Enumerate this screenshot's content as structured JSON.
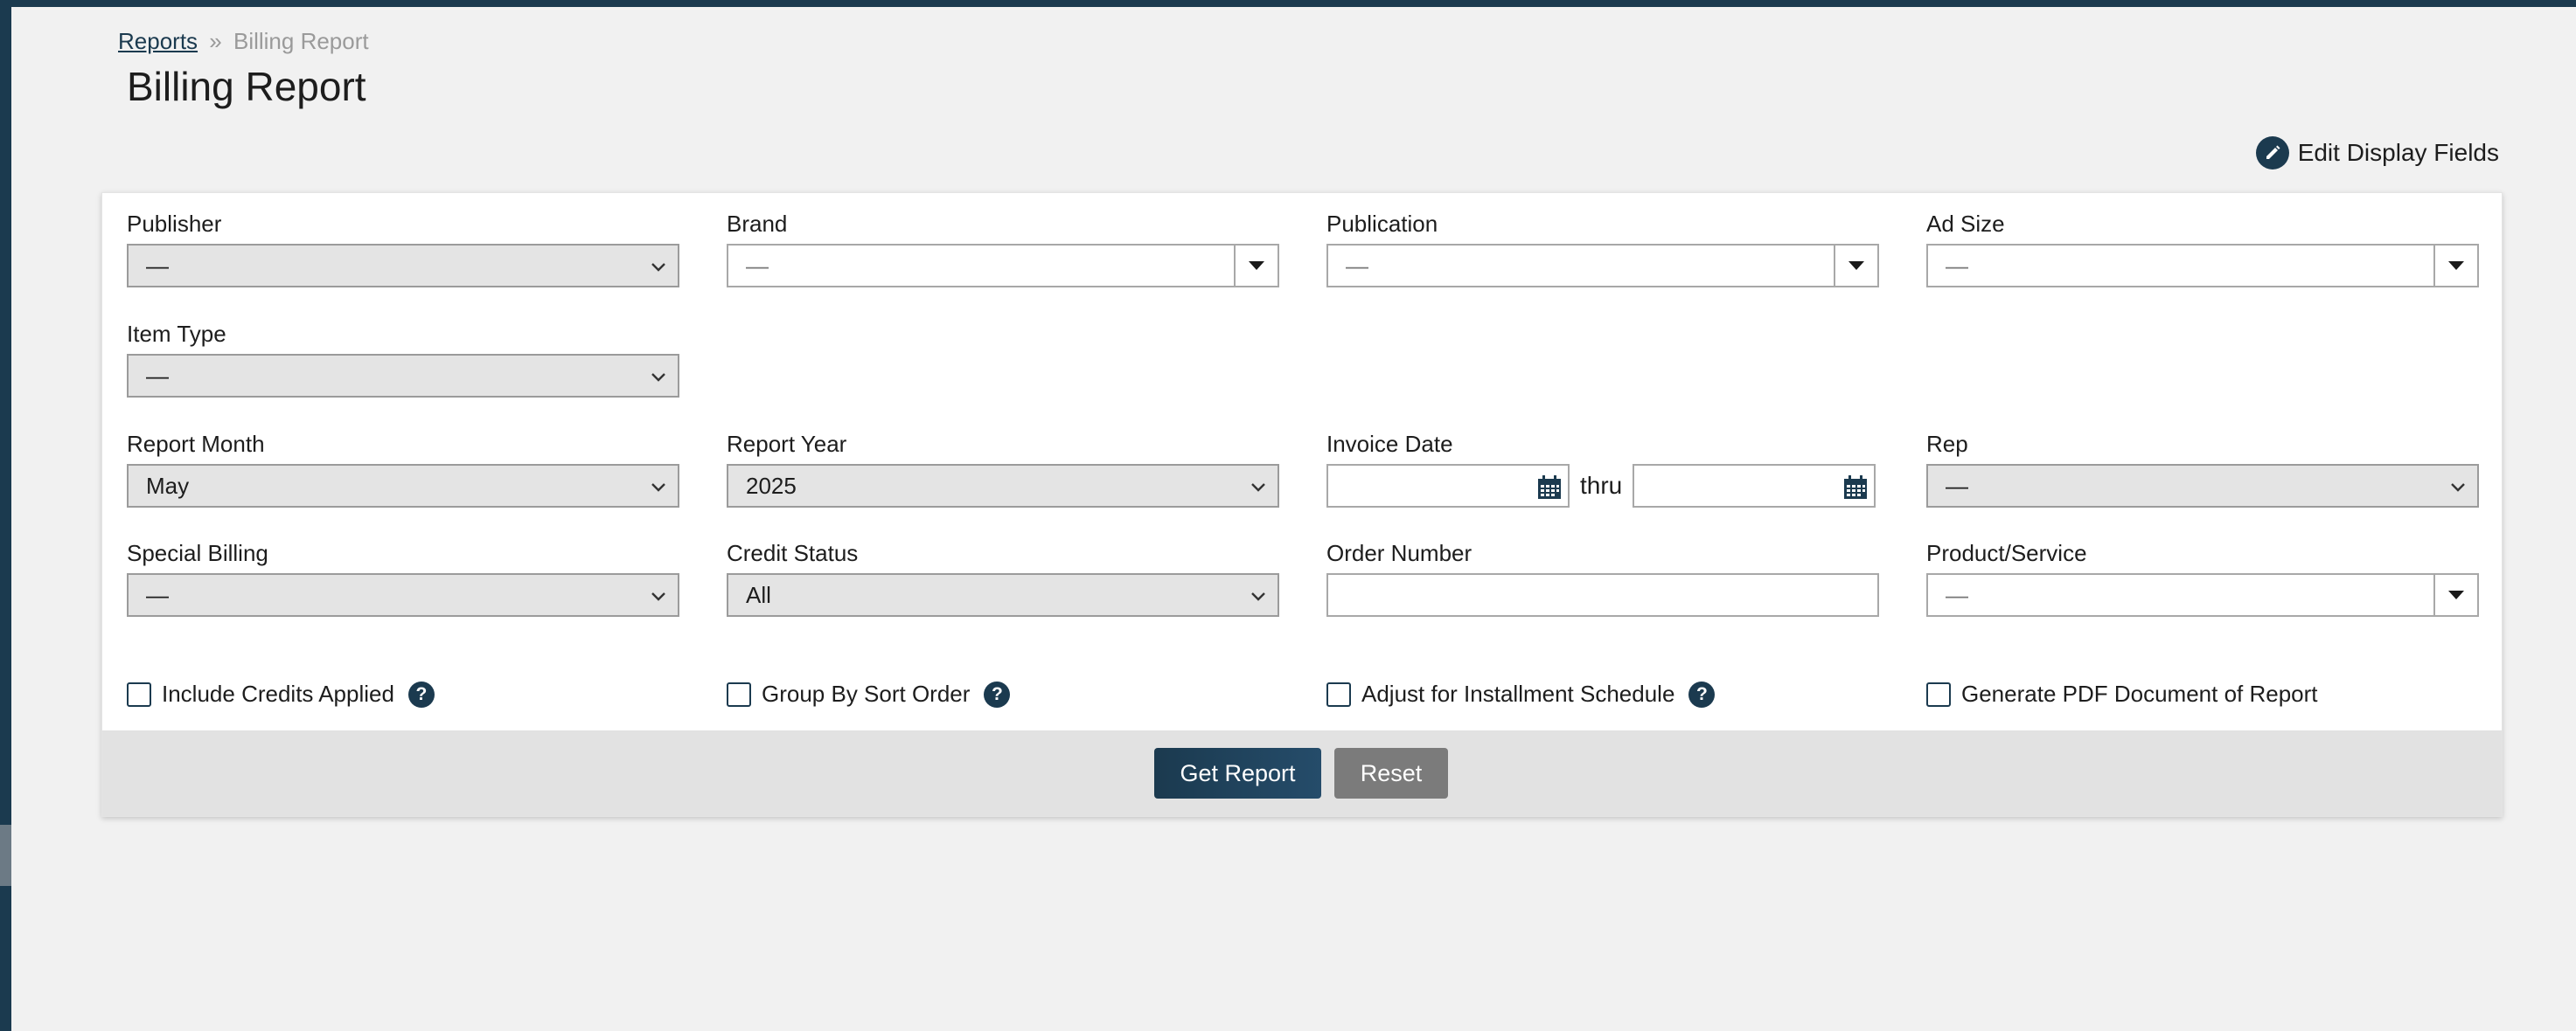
{
  "breadcrumb": {
    "parent": "Reports",
    "separator": "»",
    "current": "Billing Report"
  },
  "page_title": "Billing Report",
  "edit_fields_label": "Edit Display Fields",
  "fields": {
    "publisher": {
      "label": "Publisher",
      "value": "—"
    },
    "brand": {
      "label": "Brand",
      "value": "—"
    },
    "publication": {
      "label": "Publication",
      "value": "—"
    },
    "ad_size": {
      "label": "Ad Size",
      "value": "—"
    },
    "item_type": {
      "label": "Item Type",
      "value": "—"
    },
    "report_month": {
      "label": "Report Month",
      "value": "May"
    },
    "report_year": {
      "label": "Report Year",
      "value": "2025"
    },
    "invoice_date": {
      "label": "Invoice Date",
      "thru": "thru",
      "from": "",
      "to": ""
    },
    "rep": {
      "label": "Rep",
      "value": "—"
    },
    "special_billing": {
      "label": "Special Billing",
      "value": "—"
    },
    "credit_status": {
      "label": "Credit Status",
      "value": "All"
    },
    "order_number": {
      "label": "Order Number",
      "value": ""
    },
    "product_service": {
      "label": "Product/Service",
      "value": "—"
    }
  },
  "checkboxes": {
    "include_credits": {
      "label": "Include Credits Applied",
      "checked": false
    },
    "group_by_sort": {
      "label": "Group By Sort Order",
      "checked": false
    },
    "adjust_installment": {
      "label": "Adjust for Installment Schedule",
      "checked": false
    },
    "generate_pdf": {
      "label": "Generate PDF Document of Report",
      "checked": false
    }
  },
  "help_glyph": "?",
  "buttons": {
    "get_report": "Get Report",
    "reset": "Reset"
  },
  "colors": {
    "accent": "#1b3a4f",
    "reset": "#7b7b7b",
    "background": "#f1f1f1"
  },
  "icons": [
    "pencil-icon",
    "chevron-down-icon",
    "caret-down-icon",
    "calendar-icon",
    "help-icon"
  ]
}
